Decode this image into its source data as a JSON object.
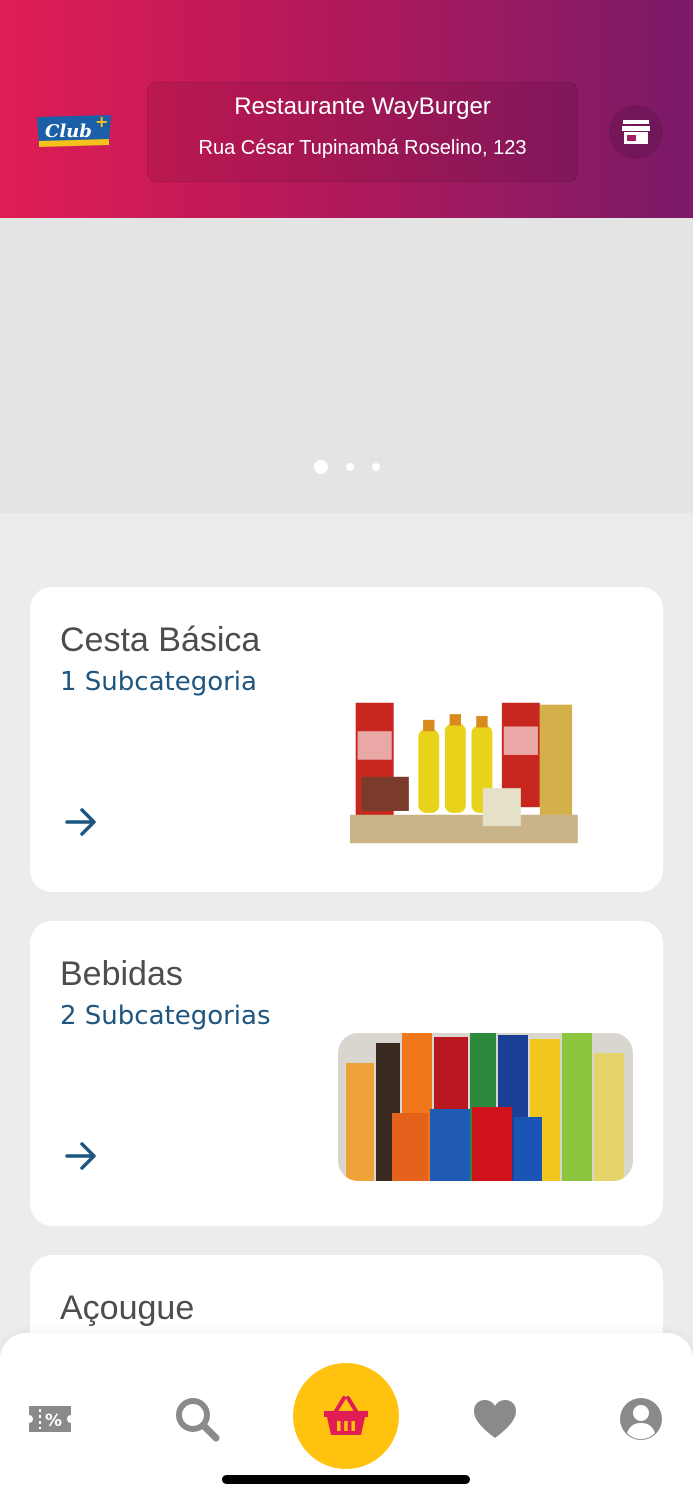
{
  "header": {
    "logo_text": "Club",
    "store_name": "Restaurante WayBurger",
    "store_address": "Rua César Tupinambá Roselino, 123",
    "store_icon": "storefront-icon"
  },
  "banner": {
    "page_count": 3,
    "active_page": 1
  },
  "categories": [
    {
      "title": "Cesta Básica",
      "subtitle": "1 Subcategoria",
      "image": "grocery-basket-image"
    },
    {
      "title": "Bebidas",
      "subtitle": "2 Subcategorias",
      "image": "drinks-image"
    },
    {
      "title": "Açougue",
      "subtitle": "",
      "image": ""
    }
  ],
  "bottom_nav": {
    "items": [
      "coupon-icon",
      "search-icon",
      "basket-icon",
      "heart-icon",
      "profile-icon"
    ],
    "active": "basket-icon"
  },
  "colors": {
    "header_start": "#e01d54",
    "header_end": "#7a1a68",
    "accent_yellow": "#ffc20e",
    "subtitle_blue": "#1f5680"
  }
}
